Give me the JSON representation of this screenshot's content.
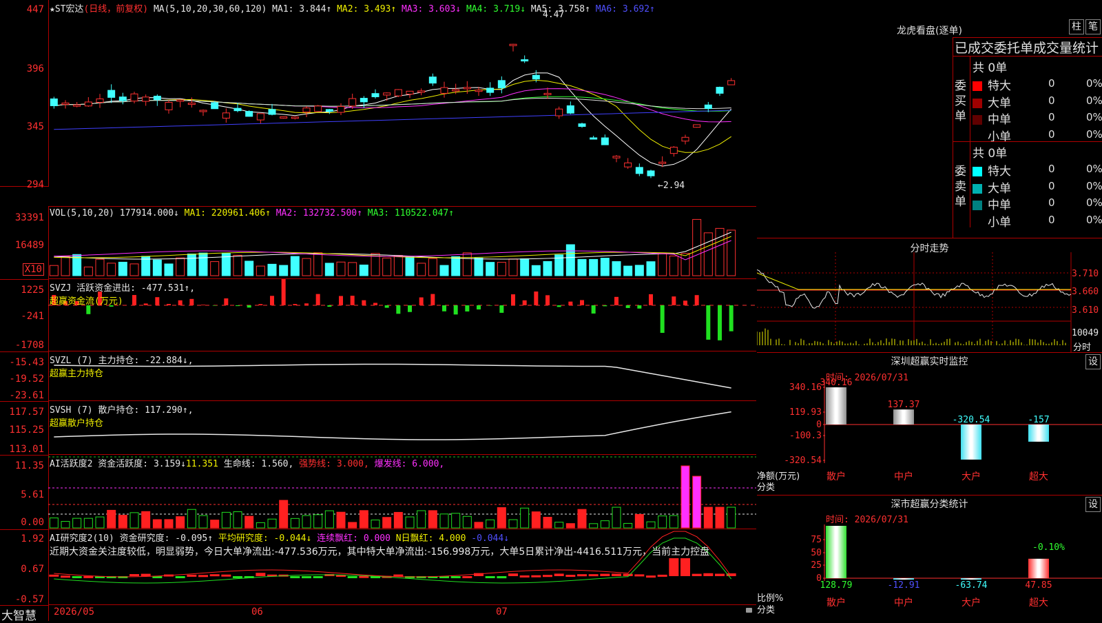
{
  "main": {
    "title": "★ST宏达",
    "period": "(日线，前复权)",
    "ma_label": "MA(5,10,20,30,60,120)",
    "ma1": "MA1: 3.844↑",
    "ma2": "MA2: 3.493↑",
    "ma3": "MA3: 3.603↓",
    "ma4": "MA4: 3.719↓",
    "ma5": "MA5: 3.758↑",
    "ma6": "MA6: 3.692↑",
    "high_mark": "4.47",
    "low_mark": "←2.94",
    "axis": [
      "447",
      "396",
      "345",
      "294"
    ]
  },
  "vol": {
    "label": "VOL(5,10,20)",
    "value": "177914.000↓",
    "ma1": "MA1: 220961.406↑",
    "ma2": "MA2: 132732.500↑",
    "ma3": "MA3: 110522.047↑",
    "axis": [
      "33391",
      "16489"
    ],
    "unit": "X10"
  },
  "svzj": {
    "label": "SVZJ  活跃资金进出: -477.531↑,",
    "sub": "超赢资金流(万元)",
    "axis": [
      "1225",
      "-241",
      "-1708"
    ]
  },
  "svzl": {
    "label": "SVZL (7) 主力持仓: -22.884↓,",
    "sub": "超赢主力持仓",
    "axis": [
      "-15.43",
      "-19.52",
      "-23.61"
    ]
  },
  "svsh": {
    "label": "SVSH (7) 散户持仓: 117.290↑,",
    "sub": "超赢散户持仓",
    "axis": [
      "117.57",
      "115.25",
      "113.01"
    ]
  },
  "ai1": {
    "label": "AI活跃度2 资金活跃度: 3.159↓",
    "v2": "11.351",
    "v3": "生命线: 1.560,",
    "v4": "强势线: 3.000,",
    "v5": "爆发线: 6.000,",
    "axis": [
      "11.35",
      "5.61",
      "0.00"
    ]
  },
  "ai2": {
    "label": "AI研究度2(10) 资金研究度: -0.095↑",
    "v2": "平均研究度: -0.044↓",
    "v3": "连续飘红: 0.000",
    "v4": "N日飘红: 4.000",
    "v5": "-0.044↓",
    "text": "近期大资金关注度较低，明显弱势，今日大单净流出:-477.536万元，其中特大单净流出:-156.998万元，大单5日累计净出-4416.511万元，当前主力控盘",
    "axis": [
      "1.92",
      "0.67",
      "-0.57"
    ]
  },
  "xaxis": [
    "2026/05",
    "06",
    "07"
  ],
  "logo": "大智慧",
  "right": {
    "dragon_title": "龙虎看盘(逐单)",
    "btn_zhu": "柱",
    "btn_bi": "笔",
    "stat_title": "已成交委托单成交量统计",
    "buy_label": "委买单",
    "sell_label": "委卖单",
    "buy_total": "共 0单",
    "sell_total": "共 0单",
    "buy_rows": [
      {
        "label": "特大",
        "count": "0",
        "pct": "0%",
        "color": "#ff0000"
      },
      {
        "label": "大单",
        "count": "0",
        "pct": "0%",
        "color": "#a00000"
      },
      {
        "label": "中单",
        "count": "0",
        "pct": "0%",
        "color": "#600000"
      },
      {
        "label": "小单",
        "count": "0",
        "pct": "0%",
        "color": ""
      }
    ],
    "sell_rows": [
      {
        "label": "特大",
        "count": "0",
        "pct": "0%",
        "color": "#00ffff"
      },
      {
        "label": "大单",
        "count": "0",
        "pct": "0%",
        "color": "#00b0b0"
      },
      {
        "label": "中单",
        "count": "0",
        "pct": "0%",
        "color": "#008080"
      },
      {
        "label": "小单",
        "count": "0",
        "pct": "0%",
        "color": ""
      }
    ],
    "intraday_title": "分时走势",
    "intraday_axis": [
      "3.710",
      "3.660",
      "3.610"
    ],
    "intraday_vol": "10049",
    "intraday_unit": "分时",
    "sz_title": "深圳超赢实时监控",
    "sz_time": "时间: 2026/07/31",
    "sz_axis": [
      "340.16",
      "119.93",
      "0",
      "-100.3",
      "-320.54"
    ],
    "sz_bars": [
      {
        "cat": "散户",
        "value": 340.16,
        "label": "340.16"
      },
      {
        "cat": "中户",
        "value": 137.37,
        "label": "137.37"
      },
      {
        "cat": "大户",
        "value": -320.54,
        "label": "-320.54"
      },
      {
        "cat": "超大",
        "value": -157,
        "label": "-157"
      }
    ],
    "sz_ylabel": "净额(万元)",
    "sz_xlabel": "分类",
    "sh_title": "深市超赢分类统计",
    "sh_time": "时间: 2026/07/31",
    "sh_axis": [
      "75",
      "50",
      "25",
      "0"
    ],
    "sh_bars": [
      {
        "cat": "散户",
        "value": 128.79,
        "label": "128.79"
      },
      {
        "cat": "中户",
        "value": -12.91,
        "label": "-12.91"
      },
      {
        "cat": "大户",
        "value": -63.74,
        "label": "-63.74"
      },
      {
        "cat": "超大",
        "value": 47.85,
        "label": "47.85"
      }
    ],
    "sh_top_label": "-0.10%",
    "sh_ylabel": "比例%",
    "sh_xlabel": "分类",
    "set": "设"
  }
}
